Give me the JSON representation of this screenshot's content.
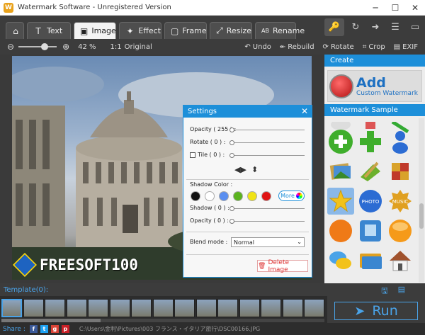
{
  "window": {
    "title": "Watermark Software - Unregistered Version",
    "app_icon": "W"
  },
  "window_controls": [
    "─",
    "☐",
    "✕"
  ],
  "tabs": [
    {
      "icon": "⌂",
      "label": ""
    },
    {
      "icon": "T",
      "label": "Text"
    },
    {
      "icon": "▣",
      "label": "Image"
    },
    {
      "icon": "✦",
      "label": "Effect"
    },
    {
      "icon": "▢",
      "label": "Frame"
    },
    {
      "icon": "⤢",
      "label": "Resize"
    },
    {
      "icon": "AB",
      "label": "Rename"
    }
  ],
  "top_icons": [
    "🔑",
    "↻",
    "➜",
    "☰",
    "▭"
  ],
  "toolbar": {
    "zoom_minus": "⊖",
    "zoom_plus": "⊕",
    "zoom_value": "42 %",
    "zoom_fraction": 0.68,
    "original_icon": "1:1",
    "original_label": "Original",
    "undo": "Undo",
    "rebuild": "Rebuild",
    "rotate": "Rotate",
    "crop": "Crop",
    "exif": "EXIF"
  },
  "watermark_text": "FREESOFT100",
  "settings": {
    "title": "Settings",
    "opacity_label": "Opacity ( 255 ) :",
    "rotate_label": "Rotate ( 0 ) :",
    "tile_label": "Tile ( 0 ) :",
    "shadow_color_label": "Shadow Color :",
    "shadow_label": "Shadow ( 0 ) :",
    "shadow_opacity_label": "Opacity ( 0 ) :",
    "blend_mode_label": "Blend mode :",
    "blend_mode_value": "Normal",
    "more_label": "More",
    "delete_label": "Delete Image",
    "swatches": [
      "#111111",
      "#ffffff",
      "#5b8ff0",
      "#5bb31f",
      "#f0e316",
      "#e01414"
    ]
  },
  "right_panel": {
    "create_header": "Create",
    "add_big": "Add",
    "add_small": "Custom Watermark",
    "sample_header": "Watermark Sample"
  },
  "template": {
    "label": "Template(0):"
  },
  "run_label": "Run",
  "status": {
    "share_label": "Share :",
    "path": "C:\\Users\\金利\\Pictures\\003 フランス・イタリア旅行\\DSC00166.JPG"
  }
}
